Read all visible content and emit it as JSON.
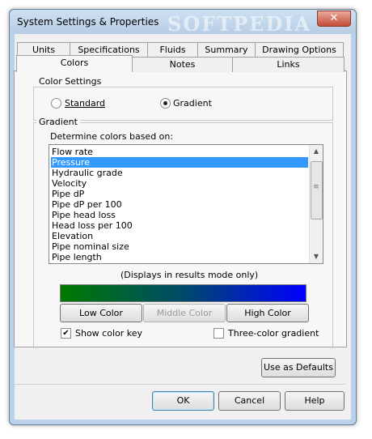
{
  "window": {
    "title": "System Settings & Properties",
    "watermark": "SOFTPEDIA",
    "close_glyph": "✕"
  },
  "tabs": {
    "row1": [
      "Units",
      "Specifications",
      "Fluids",
      "Summary",
      "Drawing Options"
    ],
    "row2": [
      "Colors",
      "Notes",
      "Links"
    ],
    "active": "Colors"
  },
  "color_settings": {
    "group_label": "Color Settings",
    "standard_label": "Standard",
    "gradient_label": "Gradient",
    "selected": "Gradient"
  },
  "gradient": {
    "group_label": "Gradient",
    "determine_label": "Determine colors based on:",
    "items": [
      "Flow rate",
      "Pressure",
      "Hydraulic grade",
      "Velocity",
      "Pipe dP",
      "Pipe dP per 100",
      "Pipe head loss",
      "Head loss per 100",
      "Elevation",
      "Pipe nominal size",
      "Pipe length"
    ],
    "selected_item": "Pressure",
    "results_note": "(Displays in results mode only)",
    "start_color": "#007a00",
    "end_color": "#0000ff",
    "low_color_label": "Low Color",
    "middle_color_label": "Middle Color",
    "high_color_label": "High Color",
    "show_color_key_label": "Show color key",
    "show_color_key_checked": true,
    "three_color_label": "Three-color gradient",
    "three_color_checked": false
  },
  "buttons": {
    "use_defaults": "Use as Defaults",
    "ok": "OK",
    "cancel": "Cancel",
    "help": "Help"
  }
}
